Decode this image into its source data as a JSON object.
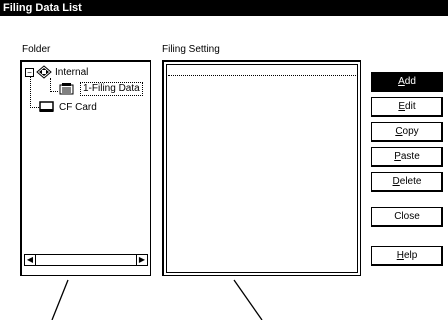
{
  "window": {
    "title": "Filing Data List"
  },
  "folder_section": {
    "label": "Folder",
    "tree": [
      {
        "label": "Internal",
        "icon": "internal-memory-icon",
        "expanded_marker": "−"
      },
      {
        "label": "1-Filing Data",
        "icon": "filing-data-icon",
        "selected": true
      },
      {
        "label": "CF Card",
        "icon": "cf-card-icon"
      }
    ],
    "scroll_left": "◀",
    "scroll_right": "▶"
  },
  "filing_section": {
    "label": "Filing Setting"
  },
  "buttons": {
    "add": {
      "mnemonic": "A",
      "rest": "dd"
    },
    "edit": {
      "mnemonic": "E",
      "rest": "dit"
    },
    "copy": {
      "mnemonic": "C",
      "rest": "opy"
    },
    "paste": {
      "mnemonic": "P",
      "rest": "aste"
    },
    "delete": {
      "mnemonic": "D",
      "rest": "elete"
    },
    "close": {
      "label": "Close"
    },
    "help": {
      "mnemonic": "H",
      "rest": "elp"
    }
  }
}
